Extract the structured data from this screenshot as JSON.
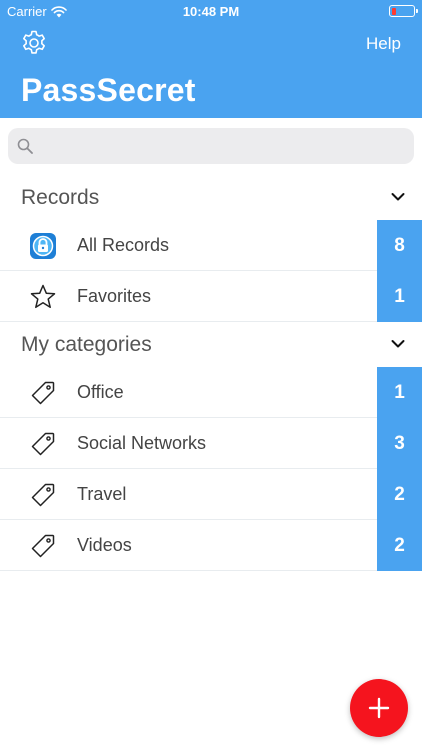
{
  "status_bar": {
    "carrier": "Carrier",
    "time": "10:48 PM"
  },
  "header": {
    "help_label": "Help",
    "app_title": "PassSecret"
  },
  "search": {
    "placeholder": ""
  },
  "sections": {
    "records": {
      "title": "Records",
      "items": [
        {
          "label": "All Records",
          "count": "8",
          "icon": "lock-app-icon"
        },
        {
          "label": "Favorites",
          "count": "1",
          "icon": "star-icon"
        }
      ]
    },
    "categories": {
      "title": "My categories",
      "items": [
        {
          "label": "Office",
          "count": "1",
          "icon": "tag-icon"
        },
        {
          "label": "Social Networks",
          "count": "3",
          "icon": "tag-icon"
        },
        {
          "label": "Travel",
          "count": "2",
          "icon": "tag-icon"
        },
        {
          "label": "Videos",
          "count": "2",
          "icon": "tag-icon"
        }
      ]
    }
  },
  "colors": {
    "accent": "#4aa3f0",
    "fab": "#f5141e",
    "battery_low": "#ff3b30"
  }
}
